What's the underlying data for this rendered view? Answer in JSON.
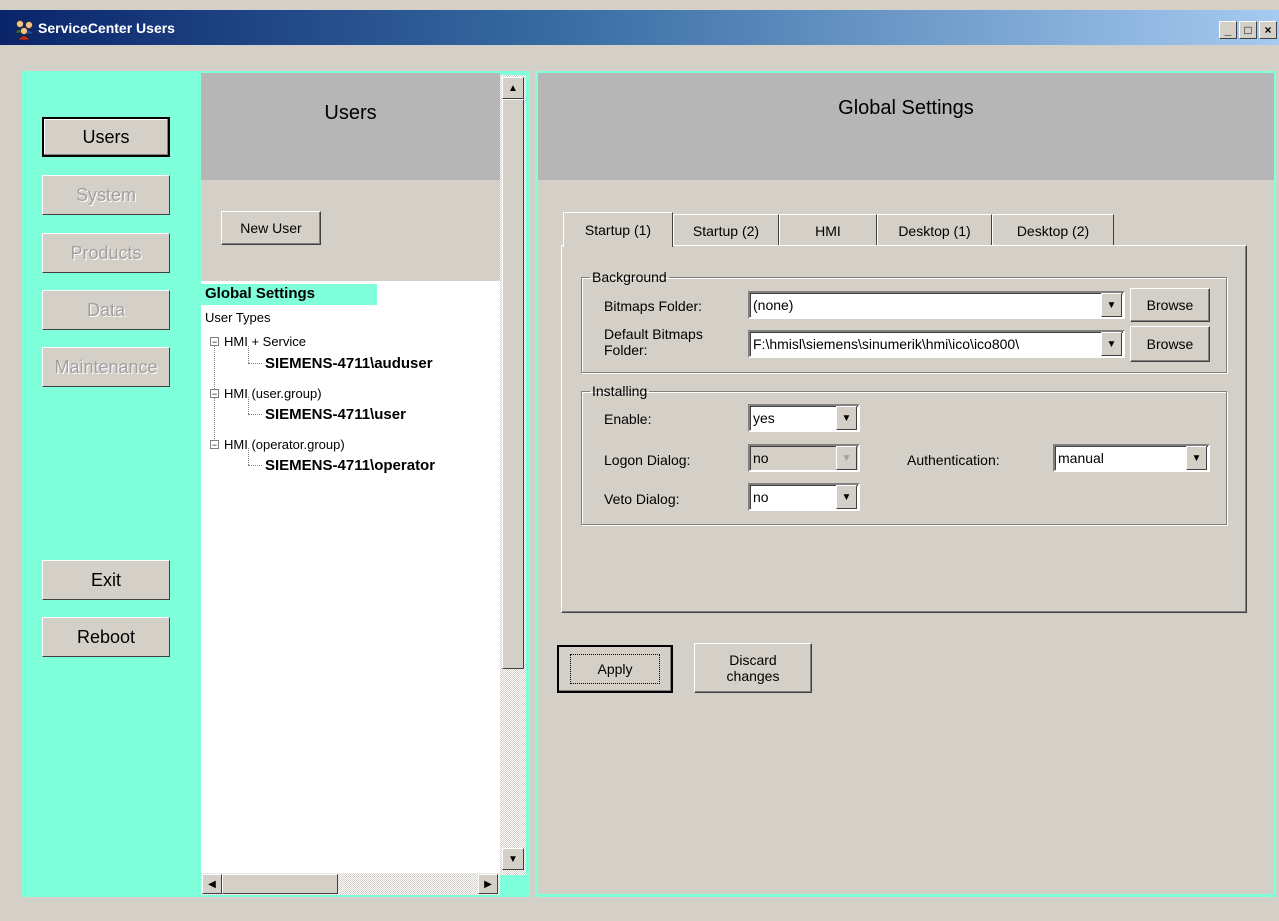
{
  "window": {
    "title": "ServiceCenter Users",
    "app_icon": "users-group-icon",
    "controls": {
      "minimize": "_",
      "maximize": "□",
      "close": "×"
    }
  },
  "sidebar": {
    "buttons": [
      {
        "label": "Users",
        "state": "active"
      },
      {
        "label": "System",
        "state": "disabled"
      },
      {
        "label": "Products",
        "state": "disabled"
      },
      {
        "label": "Data",
        "state": "disabled"
      },
      {
        "label": "Maintenance",
        "state": "disabled"
      },
      {
        "label": "Exit",
        "state": "enabled"
      },
      {
        "label": "Reboot",
        "state": "enabled"
      }
    ],
    "accent_color": "#80ffdb"
  },
  "users_panel": {
    "title": "Users",
    "new_user_label": "New User",
    "tree": {
      "global_settings": "Global Settings",
      "user_types": "User Types",
      "groups": [
        {
          "expander": "−",
          "label": "HMI + Service",
          "child": "SIEMENS-4711\\auduser"
        },
        {
          "expander": "−",
          "label": "HMI (user.group)",
          "child": "SIEMENS-4711\\user"
        },
        {
          "expander": "−",
          "label": "HMI (operator.group)",
          "child": "SIEMENS-4711\\operator"
        }
      ]
    },
    "scroll_arrows": {
      "up": "▲",
      "down": "▼",
      "left": "◀",
      "right": "▶"
    }
  },
  "global_settings": {
    "title": "Global Settings",
    "tabs": [
      "Startup (1)",
      "Startup (2)",
      "HMI",
      "Desktop (1)",
      "Desktop (2)"
    ],
    "active_tab": "Startup (1)",
    "background": {
      "legend": "Background",
      "bitmaps_folder_label": "Bitmaps Folder:",
      "bitmaps_folder_value": "(none)",
      "default_bitmaps_label_1": "Default Bitmaps",
      "default_bitmaps_label_2": "Folder:",
      "default_bitmaps_value": "F:\\hmisl\\siemens\\sinumerik\\hmi\\ico\\ico800\\",
      "browse_label": "Browse"
    },
    "installing": {
      "legend": "Installing",
      "enable_label": "Enable:",
      "enable_value": "yes",
      "logon_label": "Logon Dialog:",
      "logon_value": "no",
      "auth_label": "Authentication:",
      "auth_value": "manual",
      "veto_label": "Veto Dialog:",
      "veto_value": "no"
    },
    "apply_label": "Apply",
    "discard_label_1": "Discard",
    "discard_label_2": "changes",
    "dropdown_arrow": "▼"
  }
}
